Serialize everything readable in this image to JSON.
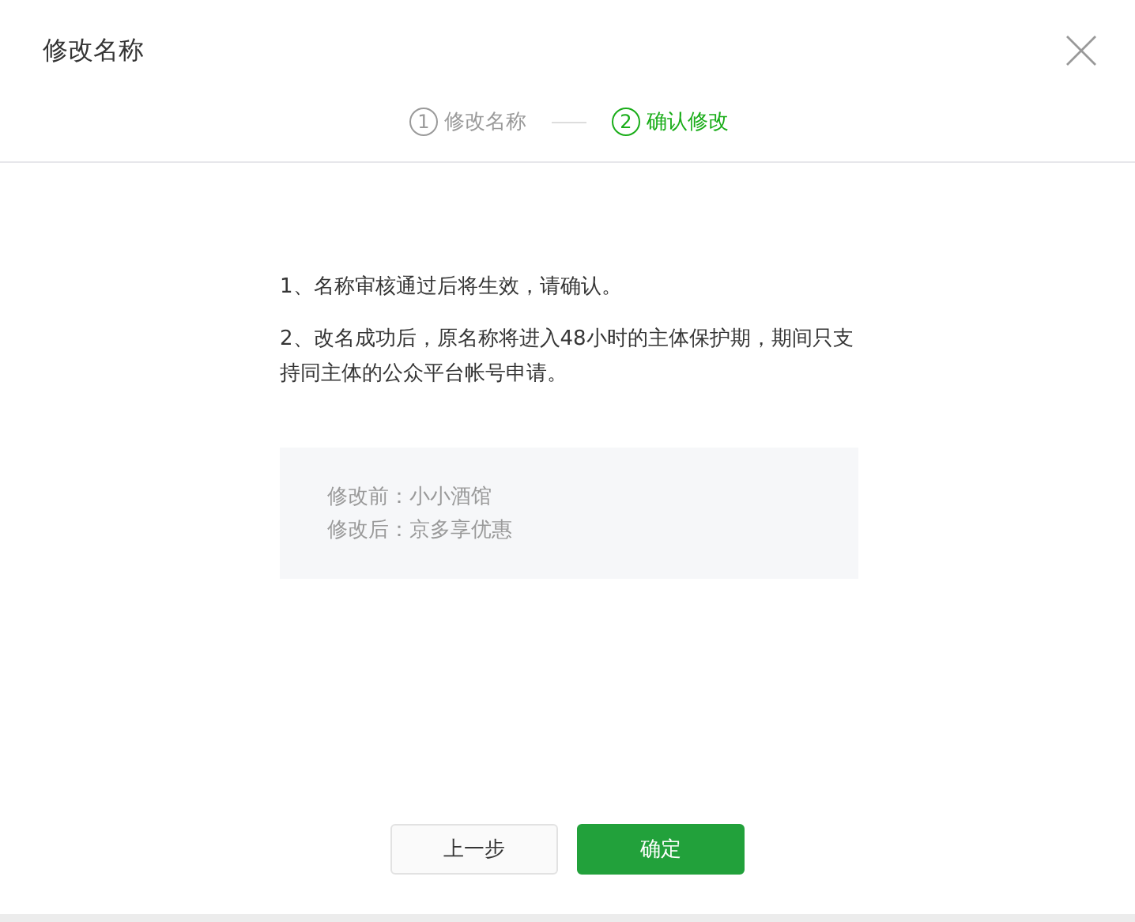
{
  "dialog": {
    "title": "修改名称"
  },
  "steps": [
    {
      "number": "1",
      "label": "修改名称",
      "selected": false
    },
    {
      "number": "2",
      "label": "确认修改",
      "selected": true
    }
  ],
  "notes": [
    "1、名称审核通过后将生效，请确认。",
    "2、改名成功后，原名称将进入48小时的主体保护期，期间只支持同主体的公众平台帐号申请。"
  ],
  "names": [
    "修改前：小小酒馆",
    "修改后：京多享优惠"
  ],
  "buttons": [
    {
      "label": "上一步",
      "kind": "secondary"
    },
    {
      "label": "确定",
      "kind": "primary"
    }
  ]
}
